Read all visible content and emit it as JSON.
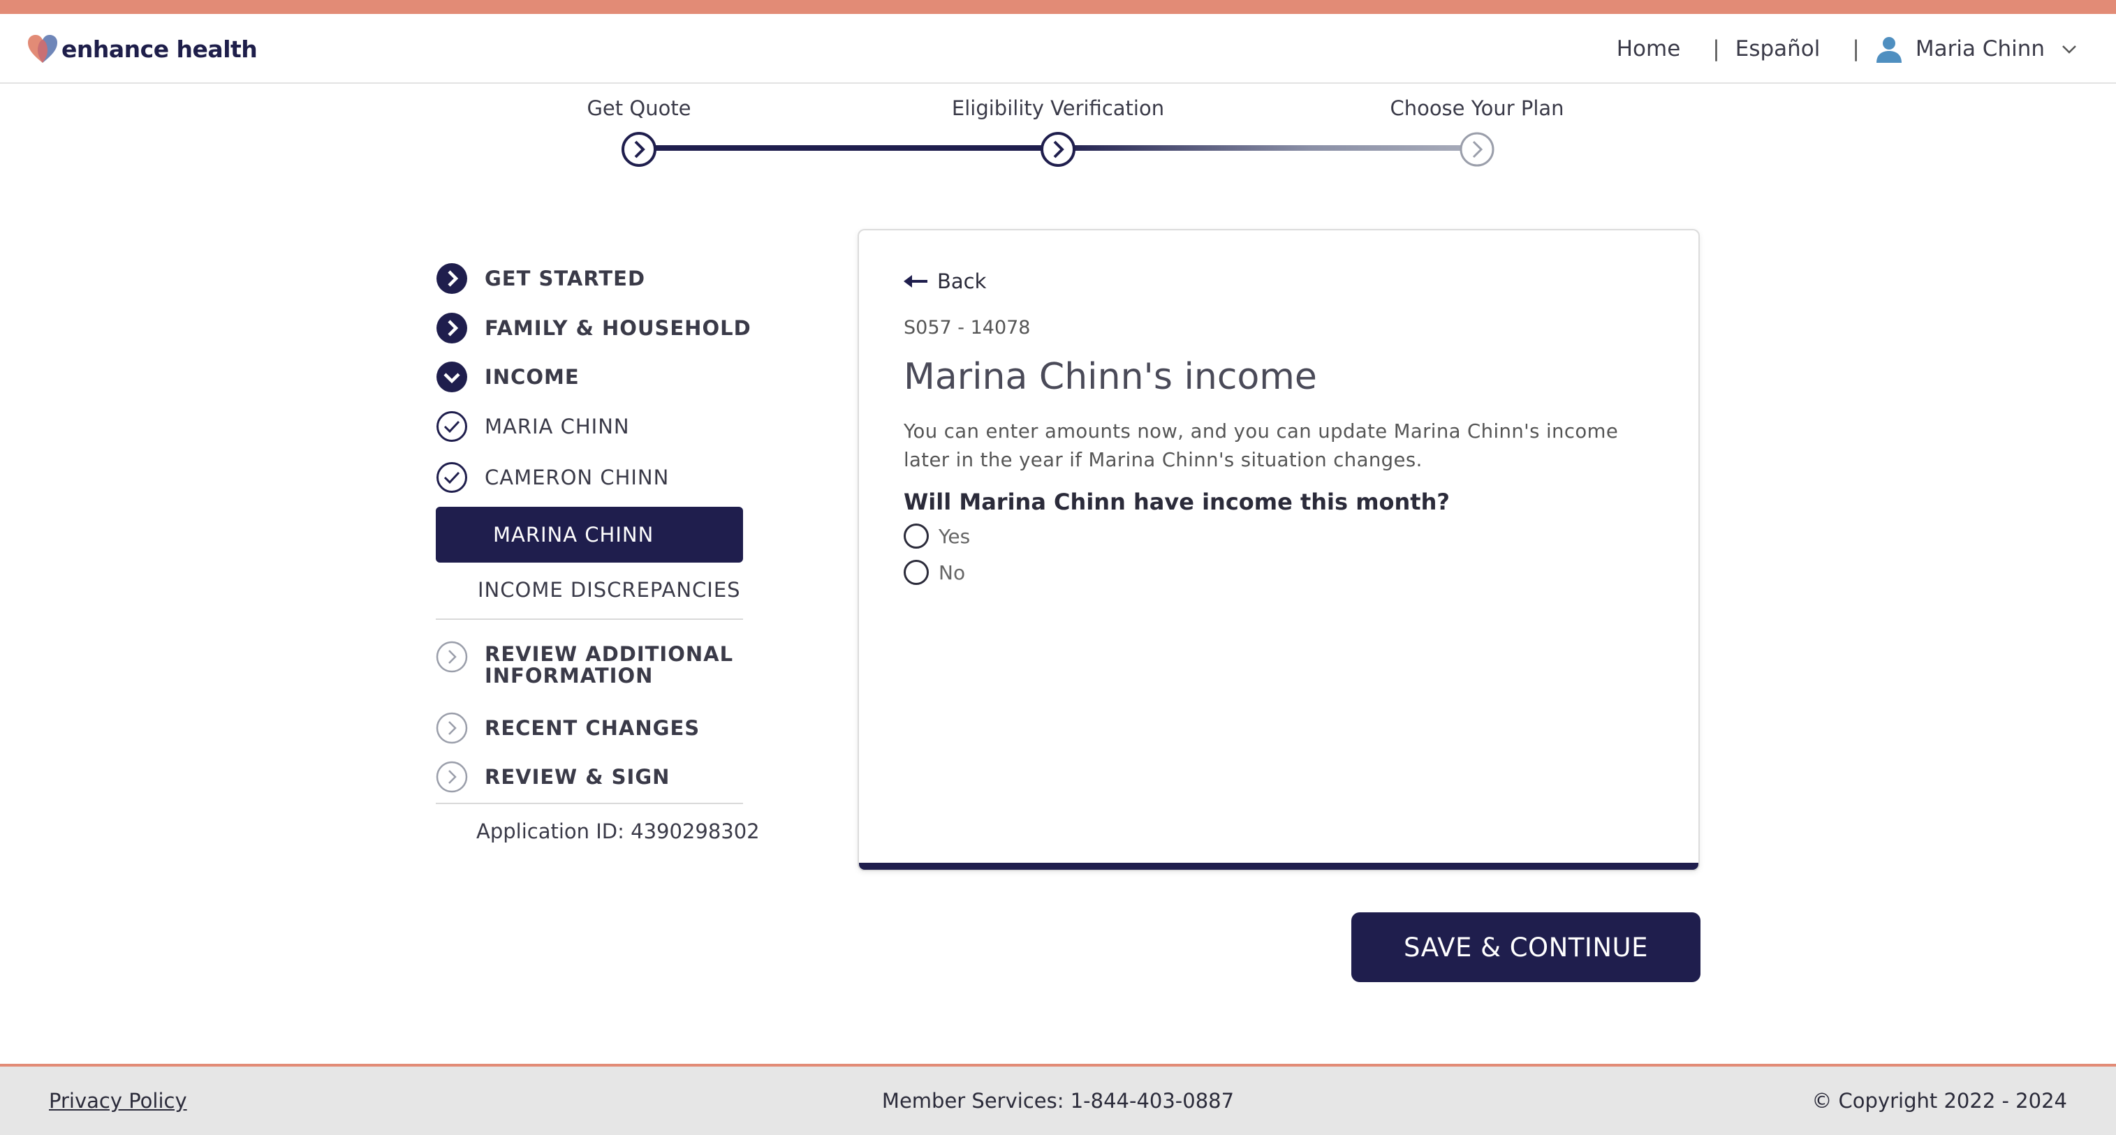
{
  "brand": {
    "name": "enhance health",
    "accent_color": "#e28b76",
    "primary_color": "#1f1e4d"
  },
  "header": {
    "nav": {
      "home": "Home",
      "language": "Español",
      "user_name": "Maria Chinn"
    },
    "separator": "|"
  },
  "stepper": {
    "steps": [
      {
        "label": "Get Quote",
        "state": "done"
      },
      {
        "label": "Eligibility Verification",
        "state": "current"
      },
      {
        "label": "Choose Your Plan",
        "state": "upcoming"
      }
    ]
  },
  "sidenav": {
    "sections": [
      {
        "label": "GET STARTED",
        "icon": "chevron-right-filled-icon"
      },
      {
        "label": "FAMILY & HOUSEHOLD",
        "icon": "chevron-right-filled-icon"
      },
      {
        "label": "INCOME",
        "icon": "chevron-down-filled-icon"
      }
    ],
    "income_members": [
      {
        "label": "MARIA CHINN",
        "icon": "check-circle-icon"
      },
      {
        "label": "CAMERON CHINN",
        "icon": "check-circle-icon"
      }
    ],
    "active_item": "MARINA CHINN",
    "income_discrepancies": "INCOME DISCREPANCIES",
    "later_sections": [
      {
        "label_line1": "REVIEW ADDITIONAL",
        "label_line2": "INFORMATION",
        "icon": "chevron-right-outline-icon"
      },
      {
        "label_line1": "RECENT CHANGES",
        "icon": "chevron-right-outline-icon"
      },
      {
        "label_line1": "REVIEW & SIGN",
        "icon": "chevron-right-outline-icon"
      }
    ],
    "application_id": "Application ID: 4390298302"
  },
  "card": {
    "back_label": "Back",
    "case_id": "S057 - 14078",
    "title": "Marina Chinn's income",
    "description": "You can enter amounts now, and you can update Marina Chinn's income later in the year if Marina Chinn's situation changes.",
    "question": "Will Marina Chinn have income this month?",
    "options": [
      "Yes",
      "No"
    ]
  },
  "actions": {
    "save_label": "SAVE & CONTINUE"
  },
  "footer": {
    "privacy": "Privacy Policy",
    "member_services": "Member Services: 1-844-403-0887",
    "copyright": "© Copyright 2022 - 2024"
  }
}
